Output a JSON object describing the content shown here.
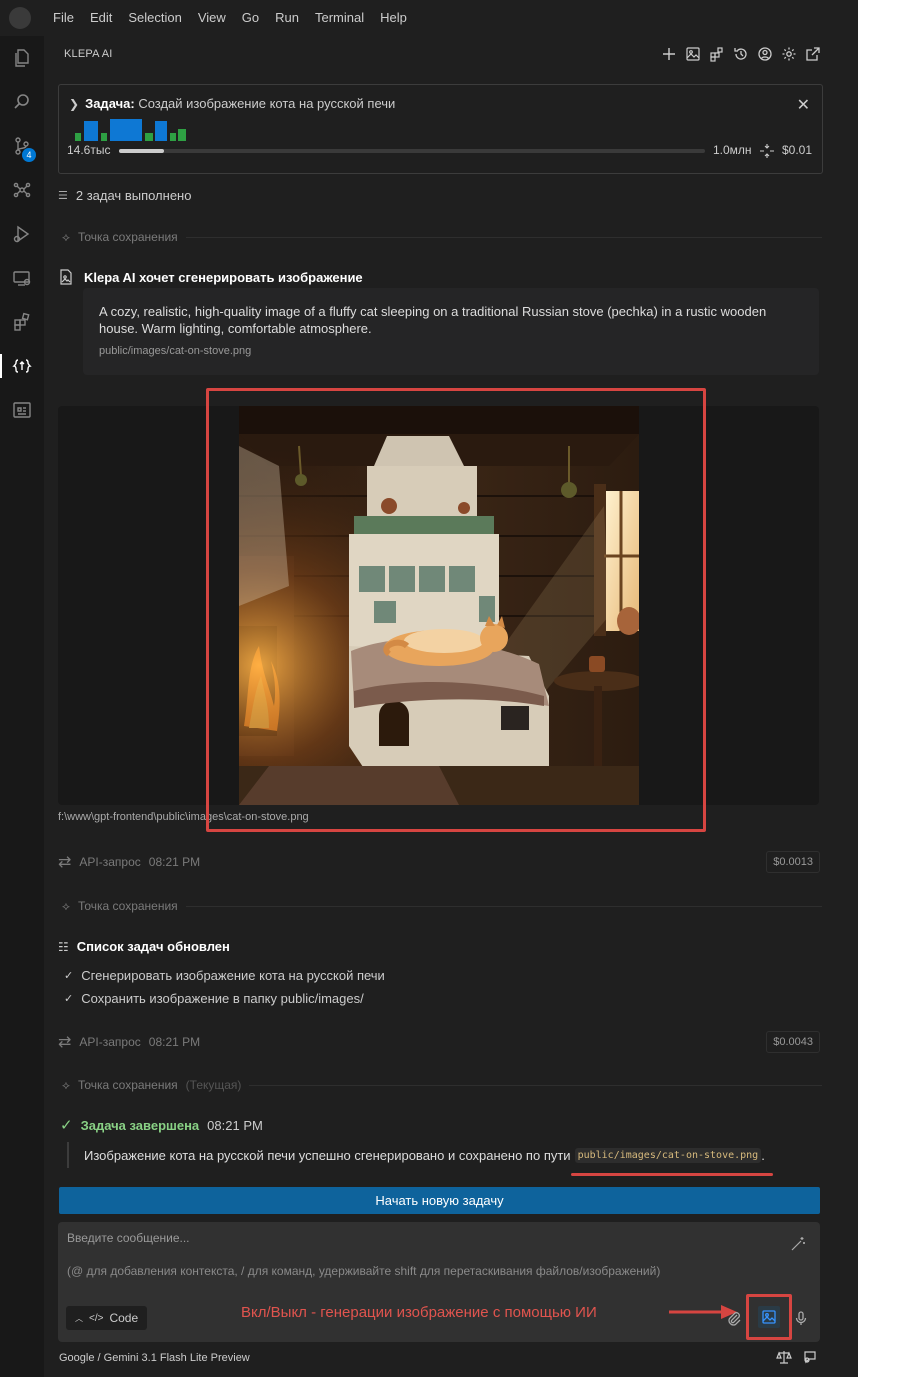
{
  "menubar": {
    "items": [
      "File",
      "Edit",
      "Selection",
      "View",
      "Go",
      "Run",
      "Terminal",
      "Help"
    ]
  },
  "activity_bar": {
    "items": [
      "explorer-icon",
      "search-icon",
      "source-control-icon",
      "extensions-tree-icon",
      "run-debug-icon",
      "remote-explorer-icon",
      "extensions-icon",
      "klepa-ai-icon",
      "preview-icon"
    ],
    "source_control_badge": "4"
  },
  "panel": {
    "title": "KLEPA AI",
    "actions": [
      "plus-icon",
      "image-gallery-icon",
      "marketplace-icon",
      "history-icon",
      "account-icon",
      "settings-icon",
      "popout-icon"
    ]
  },
  "task": {
    "label": "Задача:",
    "text": "Создай изображение кота на русской печи",
    "tokens_used": "14.6тыс",
    "tokens_max": "1.0млн",
    "context_fill_fraction": 0.076,
    "cost": "$0.01"
  },
  "tasks_done": "2 задач выполнено",
  "checkpoint_label": "Точка сохранения",
  "checkpoint_current": "(Текущая)",
  "image_request": {
    "title": "Klepa AI хочет сгенерировать изображение",
    "prompt": "A cozy, realistic, high-quality image of a fluffy cat sleeping on a traditional Russian stove (pechka) in a rustic wooden house. Warm lighting, comfortable atmosphere.",
    "path": "public/images/cat-on-stove.png",
    "full_path": "f:\\www\\gpt-frontend\\public\\images\\cat-on-stove.png"
  },
  "api_requests": [
    {
      "label": "API-запрос",
      "time": "08:21 PM",
      "cost": "$0.0013"
    },
    {
      "label": "API-запрос",
      "time": "08:21 PM",
      "cost": "$0.0043"
    }
  ],
  "todo": {
    "title": "Список задач обновлен",
    "items": [
      "Сгенерировать изображение кота на русской печи",
      "Сохранить изображение в папку public/images/"
    ]
  },
  "completion": {
    "title": "Задача завершена",
    "time": "08:21 PM",
    "text": "Изображение кота на русской печи успешно сгенерировано и сохранено по пути",
    "code": "public/images/cat-on-stove.png",
    "suffix": "."
  },
  "new_task_button": "Начать новую задачу",
  "input": {
    "placeholder": "Введите сообщение...",
    "hint": "(@ для добавления контекста, / для команд, удерживайте shift для перетаскивания файлов/изображений)",
    "mode": "Code"
  },
  "annotation": "Вкл/Выкл - генерации изображение с помощью ИИ",
  "footer": {
    "model": "Google / Gemini 3.1 Flash Lite Preview"
  },
  "colors": {
    "accent": "#0e639c",
    "annotation_red": "#d64541",
    "success": "#89d185"
  }
}
